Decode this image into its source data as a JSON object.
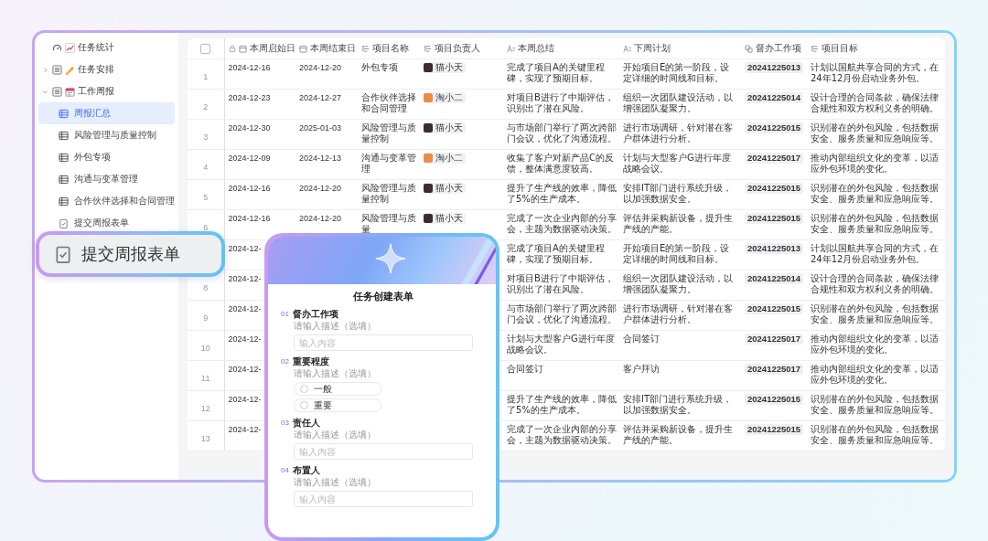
{
  "sidebar": {
    "items": [
      {
        "label": "任务统计",
        "kind": "stats",
        "selected": false
      },
      {
        "label": "任务安排",
        "kind": "schedule",
        "selected": false,
        "expanded": false
      },
      {
        "label": "工作周报",
        "kind": "report",
        "selected": false,
        "expanded": true,
        "children": [
          {
            "label": "周报汇总",
            "kind": "table",
            "selected": true
          },
          {
            "label": "风险管理与质量控制",
            "kind": "table",
            "selected": false
          },
          {
            "label": "外包专项",
            "kind": "table",
            "selected": false
          },
          {
            "label": "沟通与变革管理",
            "kind": "table",
            "selected": false
          },
          {
            "label": "合作伙伴选择和合同管理",
            "kind": "table",
            "selected": false
          },
          {
            "label": "提交周报表单",
            "kind": "form",
            "selected": false
          }
        ]
      }
    ]
  },
  "callout": {
    "label": "提交周报表单"
  },
  "table": {
    "select_all": {
      "checked": false
    },
    "columns": [
      {
        "label": "本周启始日",
        "kind": "locked-date"
      },
      {
        "label": "本周结束日",
        "kind": "date"
      },
      {
        "label": "项目名称",
        "kind": "option"
      },
      {
        "label": "项目负责人",
        "kind": "option"
      },
      {
        "label": "本周总结",
        "kind": "text"
      },
      {
        "label": "下周计划",
        "kind": "text"
      },
      {
        "label": "督办工作项",
        "kind": "link"
      },
      {
        "label": "项目目标",
        "kind": "option"
      }
    ],
    "rows": [
      {
        "index": "1",
        "start": "2024-12-16",
        "end": "2024-12-20",
        "project": "外包专项",
        "owner": {
          "name": "猫小天",
          "color": "#3b2b30"
        },
        "summary": "完成了项目A的关键里程碑，实现了预期目标。",
        "plan": "开始项目E的第一阶段，设定详细的时间线和目标。",
        "item": "20241225013",
        "goal": "计划以国航共享合同的方式，在24年12月份启动业务外包。"
      },
      {
        "index": "2",
        "start": "2024-12-23",
        "end": "2024-12-27",
        "project": "合作伙伴选择和合同管理",
        "owner": {
          "name": "淘小二",
          "color": "#f08a4b"
        },
        "summary": "对项目B进行了中期评估，识别出了潜在风险。",
        "plan": "组织一次团队建设活动，以增强团队凝聚力。",
        "item": "20241225014",
        "goal": "设计合理的合同条款，确保法律合规性和双方权利义务的明确。"
      },
      {
        "index": "3",
        "start": "2024-12-30",
        "end": "2025-01-03",
        "project": "风险管理与质量控制",
        "owner": {
          "name": "猫小天",
          "color": "#3b2b30"
        },
        "summary": "与市场部门举行了两次跨部门会议，优化了沟通流程。",
        "plan": "进行市场调研，针对潜在客户群体进行分析。",
        "item": "20241225015",
        "goal": "识别潜在的外包风险，包括数据安全、服务质量和应急响应等。"
      },
      {
        "index": "4",
        "start": "2024-12-09",
        "end": "2024-12-13",
        "project": "沟通与变革管理",
        "owner": {
          "name": "淘小二",
          "color": "#f08a4b"
        },
        "summary": "收集了客户对新产品C的反馈，整体满意度较高。",
        "plan": "计划与大型客户G进行年度战略会议。",
        "item": "20241225017",
        "goal": "推动内部组织文化的变革，以适应外包环境的变化。"
      },
      {
        "index": "5",
        "start": "2024-12-16",
        "end": "2024-12-20",
        "project": "风险管理与质量控制",
        "owner": {
          "name": "猫小天",
          "color": "#3b2b30"
        },
        "summary": "提升了生产线的效率，降低了5%的生产成本。",
        "plan": "安排IT部门进行系统升级，以加强数据安全。",
        "item": "20241225015",
        "goal": "识别潜在的外包风险，包括数据安全、服务质量和应急响应等。"
      },
      {
        "index": "6",
        "start": "2024-12-16",
        "end": "2024-12-20",
        "project": "风险管理与质量",
        "owner": {
          "name": "猫小天",
          "color": "#3b2b30"
        },
        "summary": "完成了一次企业内部的分享会，主题为数据驱动决策。",
        "plan": "评估并采购新设备，提升生产线的产能。",
        "item": "20241225015",
        "goal": "识别潜在的外包风险，包括数据安全、服务质量和应急响应等。"
      },
      {
        "start": "2024-12-",
        "summary": "完成了项目A的关键里程碑，实现了预期目标。",
        "plan": "开始项目E的第一阶段，设定详细的时间线和目标。",
        "item": "20241225013",
        "goal": "计划以国航共享合同的方式，在24年12月份启动业务外包。"
      },
      {
        "index": "8",
        "start": "2024-12-",
        "summary": "对项目B进行了中期评估，识别出了潜在风险。",
        "plan": "组织一次团队建设活动，以增强团队凝聚力。",
        "item": "20241225014",
        "goal": "设计合理的合同条款，确保法律合规性和双方权利义务的明确。"
      },
      {
        "index": "9",
        "start": "2024-12-",
        "summary": "与市场部门举行了两次跨部门会议，优化了沟通流程。",
        "plan": "进行市场调研，针对潜在客户群体进行分析。",
        "item": "20241225015",
        "goal": "识别潜在的外包风险，包括数据安全、服务质量和应急响应等。"
      },
      {
        "index": "10",
        "start": "2024-12-",
        "summary": "计划与大型客户G进行年度战略会议。",
        "plan": "合同签订",
        "item": "20241225017",
        "goal": "推动内部组织文化的变革，以适应外包环境的变化。"
      },
      {
        "index": "11",
        "start": "2024-12-",
        "summary": "合同签订",
        "plan": "客户拜访",
        "item": "20241225017",
        "goal": "推动内部组织文化的变革，以适应外包环境的变化。"
      },
      {
        "index": "12",
        "start": "2024-12-",
        "summary": "提升了生产线的效率，降低了5%的生产成本。",
        "plan": "安排IT部门进行系统升级，以加强数据安全。",
        "item": "20241225015",
        "goal": "识别潜在的外包风险，包括数据安全、服务质量和应急响应等。"
      },
      {
        "index": "13",
        "start": "2024-12-",
        "summary": "完成了一次企业内部的分享会，主题为数据驱动决策。",
        "plan": "评估并采购新设备，提升生产线的产能。",
        "item": "20241225015",
        "goal": "识别潜在的外包风险，包括数据安全、服务质量和应急响应等。"
      }
    ]
  },
  "form": {
    "title": "任务创建表单",
    "questions": [
      {
        "number": "01",
        "label": "督办工作项",
        "hint": "请输入描述（选填）",
        "kind": "input",
        "placeholder": "输入内容"
      },
      {
        "number": "02",
        "label": "重要程度",
        "hint": "请输入描述（选填）",
        "kind": "radio",
        "options": [
          {
            "label": "一般",
            "selected": false
          },
          {
            "label": "重要",
            "selected": false
          }
        ]
      },
      {
        "number": "03",
        "label": "责任人",
        "hint": "请输入描述（选填）",
        "kind": "input",
        "placeholder": "输入内容"
      },
      {
        "number": "04",
        "label": "布置人",
        "hint": "请输入描述（选填）",
        "kind": "input",
        "placeholder": "输入内容"
      }
    ]
  }
}
